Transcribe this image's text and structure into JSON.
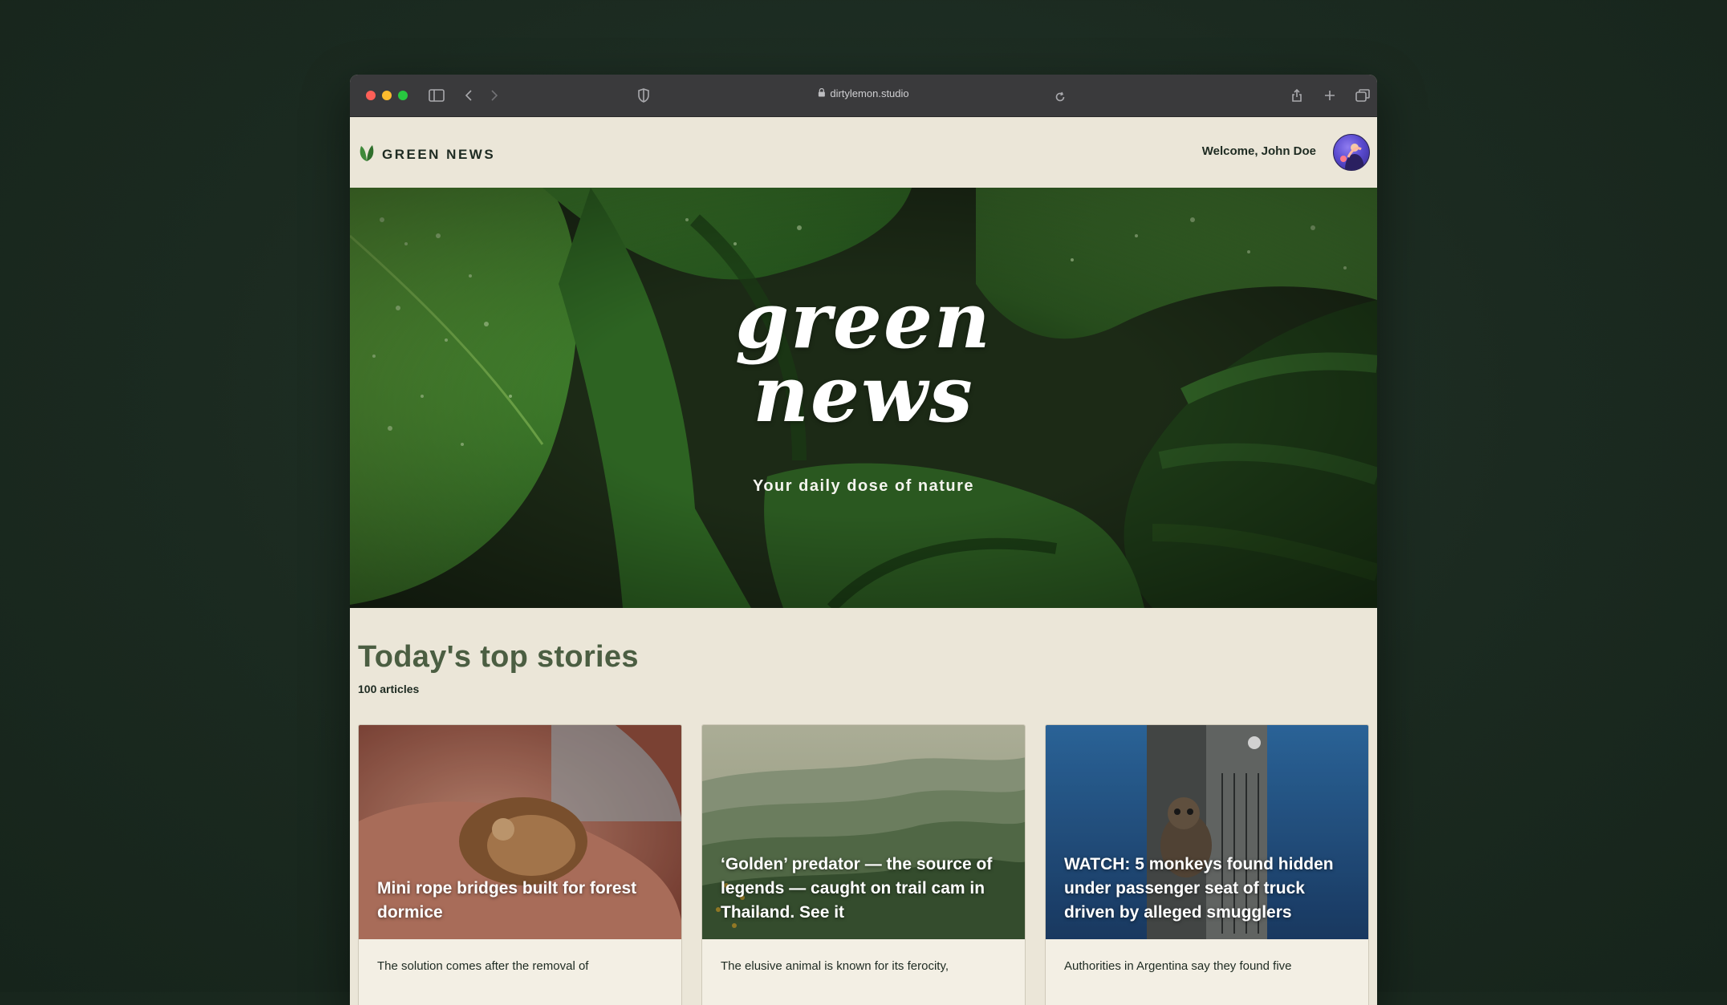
{
  "browser": {
    "url": "dirtylemon.studio"
  },
  "header": {
    "brand": "GREEN NEWS",
    "welcome": "Welcome, John Doe"
  },
  "hero": {
    "title_line1": "green",
    "title_line2": "news",
    "tagline": "Your daily dose of nature"
  },
  "stories": {
    "heading": "Today's top stories",
    "count": "100 articles",
    "cards": [
      {
        "title": "Mini rope bridges built for forest dormice",
        "excerpt": "The solution comes after the removal of"
      },
      {
        "title": "‘Golden’ predator — the source of legends — caught on trail cam in Thailand. See it",
        "excerpt": "The elusive animal is known for its ferocity,"
      },
      {
        "title": "WATCH: 5 monkeys found hidden under passenger seat of truck driven by alleged smugglers",
        "excerpt": "Authorities in Argentina say they found five"
      }
    ]
  },
  "colors": {
    "page_background": "#ebe6d8",
    "heading_green": "#4b5e42",
    "brand_leaf": "#3f8a3a"
  }
}
